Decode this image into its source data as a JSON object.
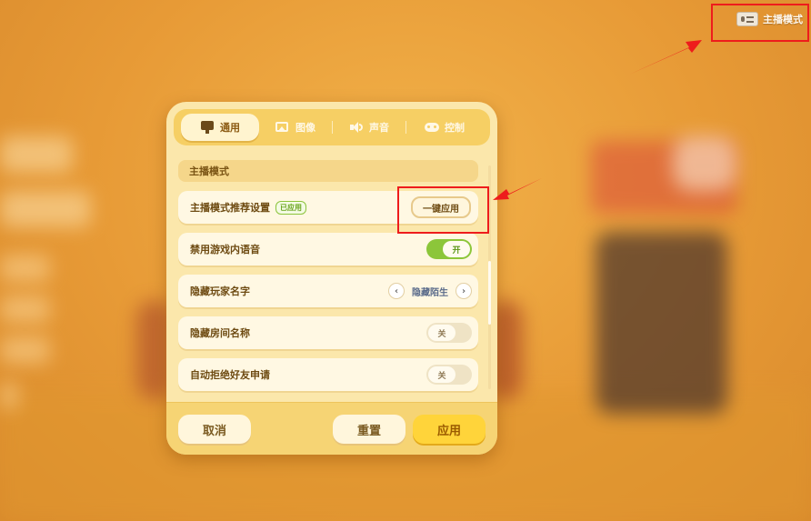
{
  "top_badge": {
    "label": "主播模式",
    "icon": "streamer-card-icon"
  },
  "tabs": [
    {
      "label": "通用",
      "icon": "monitor-icon",
      "active": true
    },
    {
      "label": "图像",
      "icon": "image-icon",
      "active": false
    },
    {
      "label": "声音",
      "icon": "speaker-icon",
      "active": false
    },
    {
      "label": "控制",
      "icon": "gamepad-icon",
      "active": false
    }
  ],
  "section": {
    "title": "主播模式"
  },
  "rows": {
    "recommend": {
      "label": "主播模式推荐设置",
      "badge": "已应用",
      "button": "一键应用"
    },
    "disable_voice": {
      "label": "禁用游戏内语音",
      "toggle": "开",
      "state": "on"
    },
    "hide_player_name": {
      "label": "隐藏玩家名字",
      "value": "隐藏陌生"
    },
    "hide_room_name": {
      "label": "隐藏房间名称",
      "toggle": "关",
      "state": "off"
    },
    "auto_reject_friend": {
      "label": "自动拒绝好友申请",
      "toggle": "关",
      "state": "off"
    }
  },
  "footer": {
    "cancel": "取消",
    "reset": "重置",
    "apply": "应用"
  },
  "colors": {
    "annotation": "#ee1c1c",
    "toggle_on": "#8cc63a",
    "accent": "#ffd43a",
    "panel": "#fbe7ab"
  }
}
